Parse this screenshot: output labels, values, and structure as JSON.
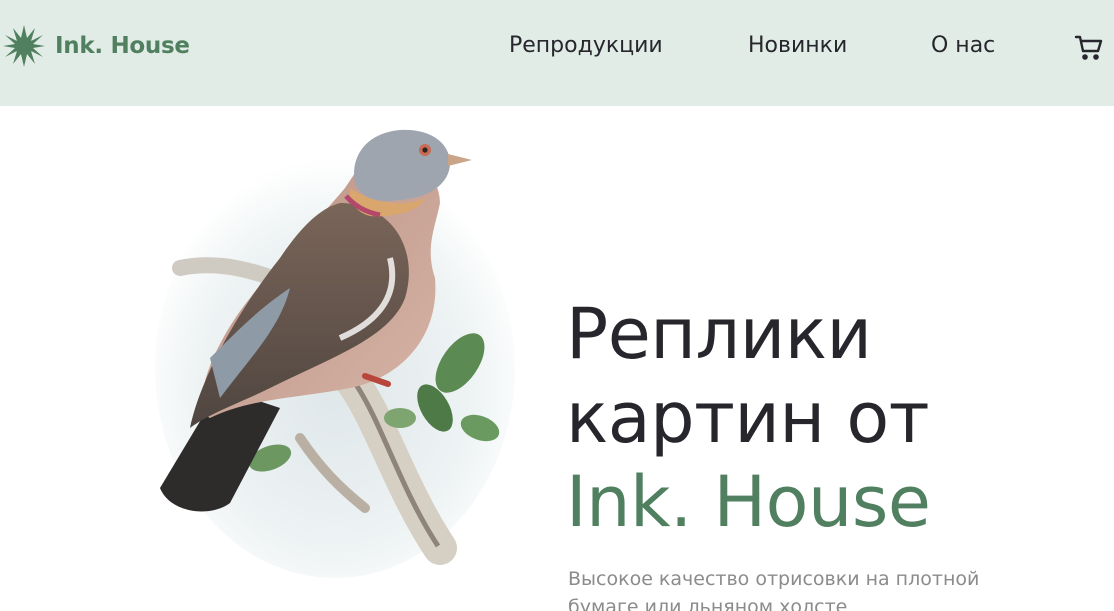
{
  "header": {
    "logo_text": "Ink. House",
    "nav": [
      {
        "label": "Репродукции"
      },
      {
        "label": "Новинки"
      },
      {
        "label": "О нас"
      }
    ],
    "icons": {
      "logo": "starburst-logo-icon",
      "cart": "cart-icon"
    }
  },
  "hero": {
    "title_line1": "Реплики",
    "title_line2": "картин от",
    "title_accent": "Ink. House",
    "description": "Высокое качество отрисовки на плотной бумаге или льняном холсте",
    "image": "pigeon-illustration"
  },
  "colors": {
    "header_bg": "#e1ece6",
    "accent": "#518060",
    "text_dark": "#26262c",
    "text_muted": "#8a8c8a"
  }
}
